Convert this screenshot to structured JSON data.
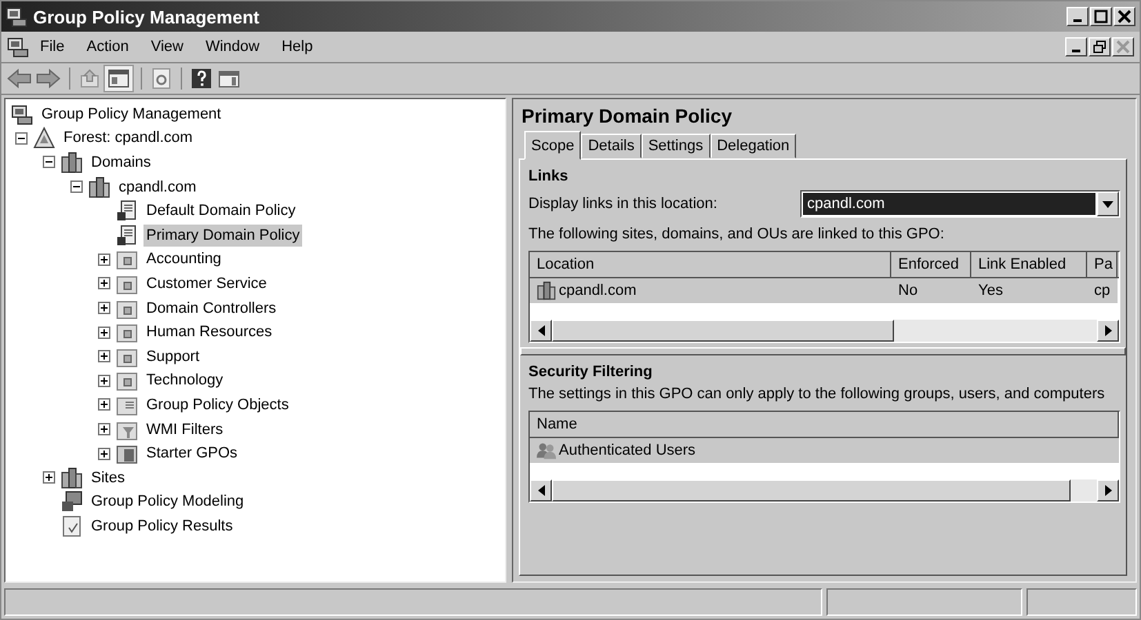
{
  "window": {
    "title": "Group Policy Management"
  },
  "menu": [
    "File",
    "Action",
    "View",
    "Window",
    "Help"
  ],
  "toolbar": [
    {
      "kind": "back"
    },
    {
      "kind": "forward"
    },
    {
      "kind": "sep"
    },
    {
      "kind": "up"
    },
    {
      "kind": "pane",
      "selected": true
    },
    {
      "kind": "sep"
    },
    {
      "kind": "refresh"
    },
    {
      "kind": "sep"
    },
    {
      "kind": "help"
    },
    {
      "kind": "panel"
    }
  ],
  "tree": [
    {
      "label": "Group Policy Management",
      "kind": "console",
      "selected": false,
      "children": [
        {
          "label": "Forest: cpandl.com",
          "kind": "forest",
          "expanded": true,
          "selected": false,
          "children": [
            {
              "label": "Domains",
              "kind": "domains",
              "expanded": true,
              "selected": false,
              "children": [
                {
                  "label": "cpandl.com",
                  "kind": "domain",
                  "expanded": true,
                  "selected": false,
                  "children": [
                    {
                      "label": "Default Domain Policy",
                      "kind": "gpo",
                      "selected": false
                    },
                    {
                      "label": "Primary Domain Policy",
                      "kind": "gpo",
                      "selected": true
                    },
                    {
                      "label": "Accounting",
                      "kind": "ou",
                      "expanded": false,
                      "selected": false
                    },
                    {
                      "label": "Customer Service",
                      "kind": "ou",
                      "expanded": false,
                      "selected": false
                    },
                    {
                      "label": "Domain Controllers",
                      "kind": "ou",
                      "expanded": false,
                      "selected": false
                    },
                    {
                      "label": "Human Resources",
                      "kind": "ou",
                      "expanded": false,
                      "selected": false
                    },
                    {
                      "label": "Support",
                      "kind": "ou",
                      "expanded": false,
                      "selected": false
                    },
                    {
                      "label": "Technology",
                      "kind": "ou",
                      "expanded": false,
                      "selected": false
                    },
                    {
                      "label": "Group Policy Objects",
                      "kind": "folder",
                      "expanded": false,
                      "selected": false
                    },
                    {
                      "label": "WMI Filters",
                      "kind": "filter",
                      "expanded": false,
                      "selected": false
                    },
                    {
                      "label": "Starter GPOs",
                      "kind": "starter",
                      "expanded": false,
                      "selected": false
                    }
                  ]
                }
              ]
            },
            {
              "label": "Sites",
              "kind": "sites",
              "expanded": false,
              "selected": false
            },
            {
              "label": "Group Policy Modeling",
              "kind": "modeling",
              "selected": false
            },
            {
              "label": "Group Policy Results",
              "kind": "results",
              "selected": false
            }
          ]
        }
      ]
    }
  ],
  "details": {
    "title": "Primary Domain Policy",
    "tabs": [
      {
        "label": "Scope",
        "selected": true
      },
      {
        "label": "Details",
        "selected": false
      },
      {
        "label": "Settings",
        "selected": false
      },
      {
        "label": "Delegation",
        "selected": false
      }
    ],
    "links": {
      "heading": "Links",
      "location_label": "Display links in this location:",
      "location_value": "cpandl.com",
      "note": "The following sites, domains, and OUs are linked to this GPO:",
      "columns": [
        "Location",
        "Enforced",
        "Link Enabled",
        "Pa"
      ],
      "rows": [
        {
          "cells": [
            "cpandl.com",
            "No",
            "Yes",
            "cp"
          ],
          "selected": true
        }
      ]
    },
    "security": {
      "heading": "Security Filtering",
      "note": "The settings in this GPO can only apply to the following groups, users, and computers",
      "columns": [
        "Name"
      ],
      "rows": [
        {
          "cells": [
            "Authenticated Users"
          ],
          "selected": true
        }
      ]
    }
  }
}
